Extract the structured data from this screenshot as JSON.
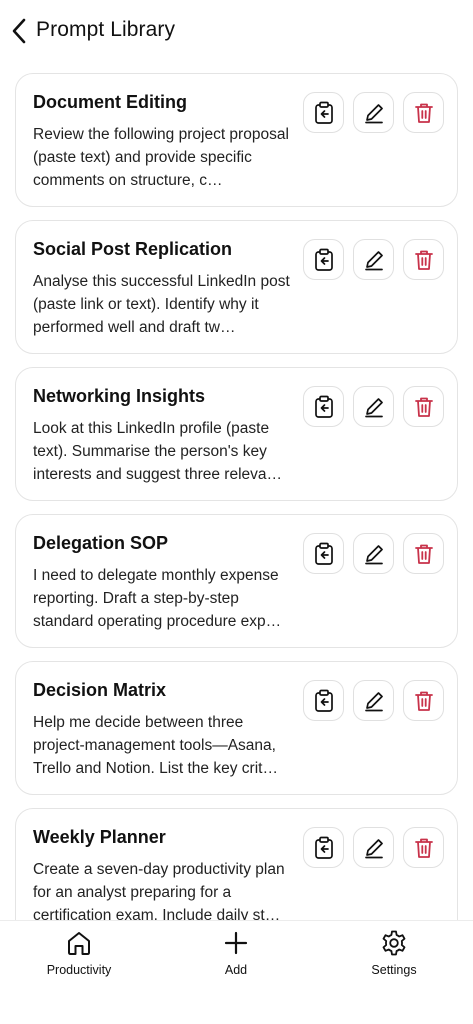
{
  "header": {
    "title": "Prompt Library",
    "back_icon": "chevron-left-icon"
  },
  "colors": {
    "delete": "#c8324a",
    "border": "#e4e4e4",
    "text": "#111111"
  },
  "prompts": [
    {
      "title": "Document Editing",
      "body": "Review the following project proposal (paste text) and provide specific comments on structure, c…"
    },
    {
      "title": "Social Post Replication",
      "body": "Analyse this successful LinkedIn post (paste link or text). Identify why it performed well and draft tw…"
    },
    {
      "title": "Networking Insights",
      "body": "Look at this LinkedIn profile (paste text). Summarise the person's key interests and suggest three releva…"
    },
    {
      "title": "Delegation SOP",
      "body": "I need to delegate monthly expense reporting. Draft a step-by-step standard operating procedure exp…"
    },
    {
      "title": "Decision Matrix",
      "body": "Help me decide between three project-management tools—Asana, Trello and Notion. List the key crit…"
    },
    {
      "title": "Weekly Planner",
      "body": "Create a seven-day productivity plan for an analyst preparing for a certification exam. Include daily st…"
    }
  ],
  "card_actions": [
    "clipboard-icon",
    "pencil-icon",
    "trash-icon"
  ],
  "tabs": [
    {
      "label": "Productivity",
      "icon": "home-icon"
    },
    {
      "label": "Add",
      "icon": "plus-icon"
    },
    {
      "label": "Settings",
      "icon": "gear-icon"
    }
  ]
}
